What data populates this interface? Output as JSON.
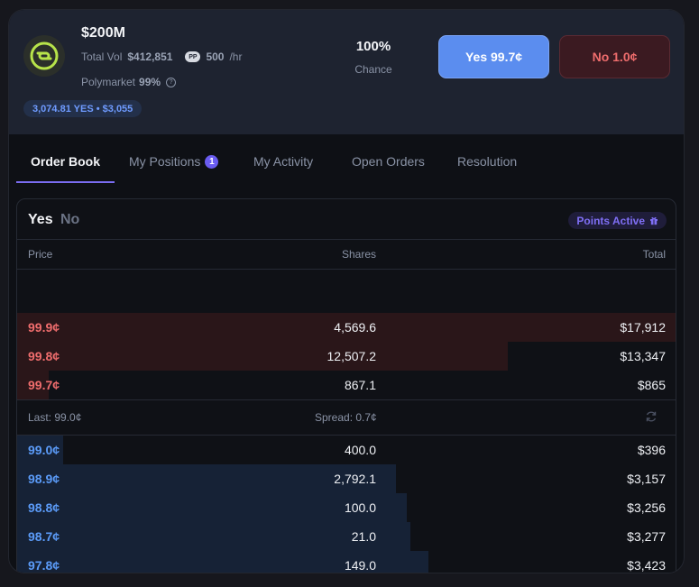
{
  "market": {
    "title": "$200M",
    "volume_label": "Total Vol",
    "volume_value": "$412,851",
    "rate_icon_text": "PP",
    "rate_value": "500",
    "rate_unit": "/hr",
    "source": "Polymarket",
    "source_pct": "99%",
    "position_badge": "3,074.81 YES • $3,055"
  },
  "chance": {
    "value": "100%",
    "label": "Chance"
  },
  "actions": {
    "yes_label": "Yes 99.7¢",
    "no_label": "No 1.0¢"
  },
  "tabs": [
    {
      "label": "Order Book"
    },
    {
      "label": "My Positions",
      "count": "1"
    },
    {
      "label": "My Activity"
    },
    {
      "label": "Open Orders"
    },
    {
      "label": "Resolution"
    }
  ],
  "book": {
    "side_yes": "Yes",
    "side_no": "No",
    "points_label": "Points Active",
    "columns": {
      "price": "Price",
      "shares": "Shares",
      "total": "Total"
    },
    "asks": [
      {
        "price": "99.9¢",
        "shares": "4,569.6",
        "total": "$17,912",
        "depth": 1.0
      },
      {
        "price": "99.8¢",
        "shares": "12,507.2",
        "total": "$13,347",
        "depth": 0.745
      },
      {
        "price": "99.7¢",
        "shares": "867.1",
        "total": "$865",
        "depth": 0.048
      }
    ],
    "spread": {
      "last": "Last: 99.0¢",
      "spread": "Spread: 0.7¢"
    },
    "bids": [
      {
        "price": "99.0¢",
        "shares": "400.0",
        "total": "$396",
        "depth": 0.07
      },
      {
        "price": "98.9¢",
        "shares": "2,792.1",
        "total": "$3,157",
        "depth": 0.575
      },
      {
        "price": "98.8¢",
        "shares": "100.0",
        "total": "$3,256",
        "depth": 0.592
      },
      {
        "price": "98.7¢",
        "shares": "21.0",
        "total": "$3,277",
        "depth": 0.597
      },
      {
        "price": "97.8¢",
        "shares": "149.0",
        "total": "$3,423",
        "depth": 0.625
      }
    ]
  },
  "colors": {
    "accent": "#6a5cf0",
    "yes": "#5b8def",
    "no": "#ef6d6d"
  }
}
